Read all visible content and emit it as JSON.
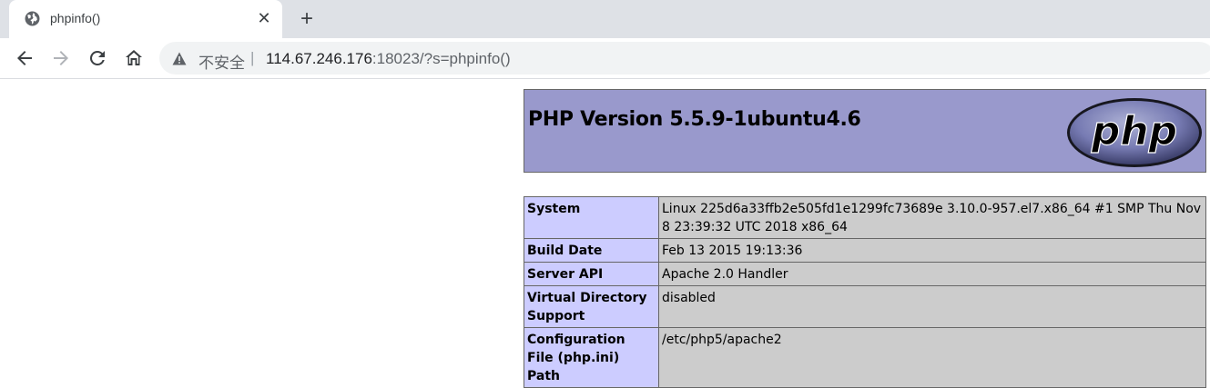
{
  "browser": {
    "tab": {
      "title": "phpinfo()",
      "favicon": "globe-icon"
    },
    "new_tab_label": "+",
    "close_label": "✕",
    "security_label": "不安全",
    "url_separator": "|",
    "url_host": "114.67.246.176",
    "url_rest": ":18023/?s=phpinfo()"
  },
  "page": {
    "title": "PHP Version 5.5.9-1ubuntu4.6",
    "logo_text": "php",
    "rows": [
      {
        "label": "System",
        "value": "Linux 225d6a33ffb2e505fd1e1299fc73689e 3.10.0-957.el7.x86_64 #1 SMP Thu Nov 8 23:39:32 UTC 2018 x86_64"
      },
      {
        "label": "Build Date",
        "value": "Feb 13 2015 19:13:36"
      },
      {
        "label": "Server API",
        "value": "Apache 2.0 Handler"
      },
      {
        "label": "Virtual Directory Support",
        "value": "disabled"
      },
      {
        "label": "Configuration File (php.ini) Path",
        "value": "/etc/php5/apache2"
      }
    ]
  },
  "colors": {
    "header_bg": "#9999cc",
    "label_bg": "#ccccff",
    "value_bg": "#cccccc",
    "tabstrip_bg": "#dee1e6"
  }
}
